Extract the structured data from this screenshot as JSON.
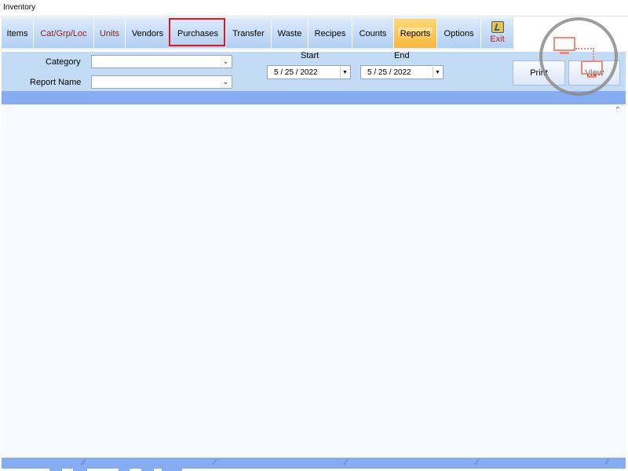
{
  "window": {
    "title": "Inventory"
  },
  "tabs": {
    "items": "Items",
    "cat_grp_loc": "Cat/Grp/Loc",
    "units": "Units",
    "vendors": "Vendors",
    "purchases": "Purchases",
    "transfer": "Transfer",
    "waste": "Waste",
    "recipes": "Recipes",
    "counts": "Counts",
    "reports": "Reports",
    "options": "Options",
    "exit": "Exit"
  },
  "filters": {
    "category_label": "Category",
    "category_value": "",
    "report_name_label": "Report Name",
    "report_name_value": "",
    "start_label": "Start",
    "start_value": "5 / 25 / 2022",
    "end_label": "End",
    "end_value": "5 / 25 / 2022"
  },
  "buttons": {
    "print": "Print",
    "view": "View"
  },
  "state": {
    "active_tab": "Reports",
    "highlighted_tab": "Purchases"
  },
  "colors": {
    "tab_blue": "#c5dbf7",
    "active_tab": "#f9b73d",
    "highlight_box": "#e01818",
    "panel": "#c4dbf6",
    "strip": "#86adf2",
    "red_label": "#8a1c1c"
  },
  "icons": {
    "exit": "exit-door-icon",
    "dropdown": "chevron-down-icon",
    "remote": "remote-desktop-icon"
  }
}
